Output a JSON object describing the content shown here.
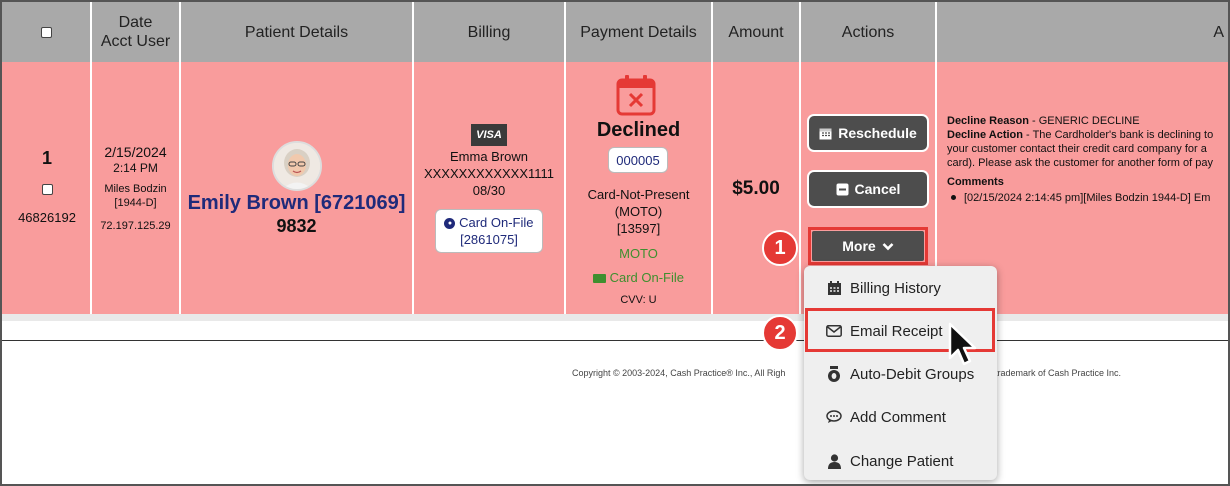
{
  "header": {
    "date_line1": "Date",
    "date_line2": "Acct User",
    "patient": "Patient Details",
    "billing": "Billing",
    "payment": "Payment Details",
    "amount": "Amount",
    "actions": "Actions",
    "extra": "A"
  },
  "row": {
    "index": "1",
    "transaction_id": "46826192",
    "date": "2/15/2024",
    "time": "2:14 PM",
    "user": "Miles Bodzin",
    "user_code": "[1944-D]",
    "ip": "72.197.125.29",
    "patient_name": "Emily Brown [6721069]",
    "patient_code": "9832",
    "card_brand": "VISA",
    "card_holder": "Emma Brown",
    "card_number": "XXXXXXXXXXXX1111",
    "card_expiry": "08/30",
    "card_on_file_label": "Card On-File",
    "card_on_file_id": "[2861075]",
    "payment_status": "Declined",
    "payment_code": "000005",
    "payment_type": "Card-Not-Present",
    "payment_moto": "(MOTO)",
    "payment_id": "[13597]",
    "payment_moto_green": "MOTO",
    "payment_cof_green": "Card On-File",
    "cvv": "CVV: U",
    "amount": "$5.00",
    "decline_reason_label": "Decline Reason",
    "decline_reason_value": " - GENERIC DECLINE",
    "decline_action_label": "Decline Action",
    "decline_action_value": " - The Cardholder's bank is declining to",
    "decline_action_line2": "your customer contact their credit card company for a",
    "decline_action_line3": "card). Please ask the customer for another form of pay",
    "comments_label": "Comments",
    "comment_1": "[02/15/2024 2:14:45 pm][Miles Bodzin 1944-D] Em"
  },
  "actions": {
    "reschedule": "Reschedule",
    "cancel": "Cancel",
    "more": "More"
  },
  "menu": {
    "items": [
      {
        "label": "Billing History",
        "icon": "calendar-icon"
      },
      {
        "label": "Email Receipt",
        "icon": "envelope-icon"
      },
      {
        "label": "Auto-Debit Groups",
        "icon": "piggy-icon"
      },
      {
        "label": "Add Comment",
        "icon": "comment-icon"
      },
      {
        "label": "Change Patient",
        "icon": "user-icon"
      }
    ]
  },
  "callouts": {
    "first": "1",
    "second": "2"
  },
  "footer": {
    "copyright_left": "Copyright © 2003-2024, Cash Practice® Inc., All Righ",
    "copyright_right": "trademark of Cash Practice Inc."
  },
  "colors": {
    "row_bg": "#f99c9c",
    "header_bg": "#a9a9a9",
    "accent_red": "#e53935",
    "link_blue": "#1f2a7a",
    "moto_green": "#3f8f2f"
  }
}
